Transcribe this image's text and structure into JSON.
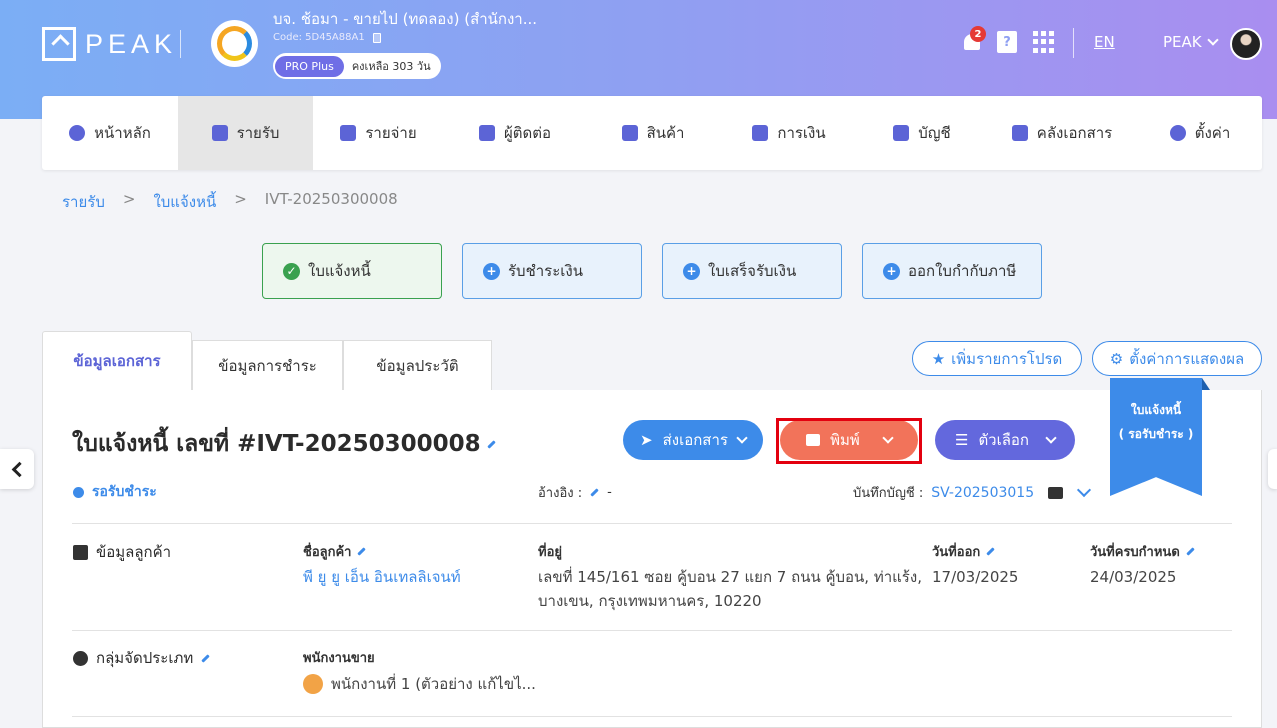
{
  "brand": {
    "logo_text": "PEAK"
  },
  "company": {
    "name": "บจ. ช้อมา - ขายไป (ทดลอง) (สำนักงา...",
    "code": "Code: 5D45A88A1",
    "plan": "PRO Plus",
    "remaining": "คงเหลือ 303 วัน"
  },
  "header": {
    "notification_count": "2",
    "help_glyph": "?",
    "language": "EN",
    "user_name": "PEAK"
  },
  "nav": [
    {
      "label": "หน้าหลัก",
      "icon": "dashboard-icon"
    },
    {
      "label": "รายรับ",
      "icon": "income-icon",
      "active": true
    },
    {
      "label": "รายจ่าย",
      "icon": "expense-icon"
    },
    {
      "label": "ผู้ติดต่อ",
      "icon": "contacts-icon"
    },
    {
      "label": "สินค้า",
      "icon": "box-icon"
    },
    {
      "label": "การเงิน",
      "icon": "money-icon"
    },
    {
      "label": "บัญชี",
      "icon": "ledger-icon"
    },
    {
      "label": "คลังเอกสาร",
      "icon": "folder-icon"
    },
    {
      "label": "ตั้งค่า",
      "icon": "gear-icon"
    }
  ],
  "breadcrumb": {
    "items": [
      "รายรับ",
      "ใบแจ้งหนี้",
      "IVT-20250300008"
    ],
    "separator": ">"
  },
  "steps": [
    {
      "label": "ใบแจ้งหนี้",
      "state": "done"
    },
    {
      "label": "รับชำระเงิน",
      "state": "todo"
    },
    {
      "label": "ใบเสร็จรับเงิน",
      "state": "todo"
    },
    {
      "label": "ออกใบกำกับภาษี",
      "state": "todo"
    }
  ],
  "tabs": [
    "ข้อมูลเอกสาร",
    "ข้อมูลการชำระ",
    "ข้อมูลประวัติ"
  ],
  "toolbar": {
    "favorite_label": "เพิ่มรายการโปรด",
    "display_settings_label": "ตั้งค่าการแสดงผล"
  },
  "ribbon": {
    "line1": "ใบแจ้งหนี้",
    "line2": "( รอรับชำระ )"
  },
  "document": {
    "title": "ใบแจ้งหนี้ เลขที่ #IVT-20250300008",
    "status": "รอรับชำระ",
    "reference_label": "อ้างอิง :",
    "reference_value": "-",
    "posting_label": "บันทึกบัญชี :",
    "posting_value": "SV-202503015"
  },
  "actions": {
    "send": "ส่งเอกสาร",
    "print": "พิมพ์",
    "options": "ตัวเลือก"
  },
  "customer": {
    "section_title": "ข้อมูลลูกค้า",
    "name_label": "ชื่อลูกค้า",
    "name_value": "พี ยู ยู เอ็น อินเทลลิเจนท์",
    "address_label": "ที่อยู่",
    "address_line1": "เลขที่ 145/161 ซอย คู้บอน 27 แยก 7 ถนน คู้บอน, ท่าแร้ง,",
    "address_line2": "บางเขน, กรุงเทพมหานคร, 10220",
    "issue_label": "วันที่ออก",
    "issue_value": "17/03/2025",
    "due_label": "วันที่ครบกำหนด",
    "due_value": "24/03/2025"
  },
  "category": {
    "section_title": "กลุ่มจัดประเภท",
    "salesperson_label": "พนักงานขาย",
    "salesperson_value": "พนักงานที่ 1 (ตัวอย่าง แก้ไขไ..."
  },
  "colors": {
    "primary": "#3d8be9",
    "accent_purple": "#6368dd",
    "print_orange": "#f2735a",
    "success_green": "#3aa14f",
    "highlight_red": "#e3000f"
  }
}
